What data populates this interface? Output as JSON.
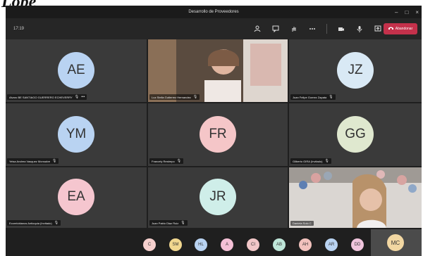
{
  "top_text": "Lope",
  "window": {
    "title": "Desarrollo de Proveedores",
    "minimize_glyph": "–",
    "maximize_glyph": "□",
    "close_glyph": "×"
  },
  "toolbar": {
    "timer": "17:19",
    "leave_label": "Abandonar",
    "icons": [
      "people-icon",
      "chat-icon",
      "raise-hand-icon",
      "more-options-icon",
      "camera-icon",
      "microphone-icon",
      "share-icon"
    ]
  },
  "tiles": [
    {
      "initials": "AE",
      "name": "Alvaro BE SANTIAGO GUERRERO ECHEVERRY",
      "color": "#b9d3f2"
    },
    {
      "initials": "",
      "name": "Luz Stella Gutierrez Hernandez",
      "color": "#c8a27c"
    },
    {
      "initials": "JZ",
      "name": "Juan Felipe Gomez Zapata",
      "color": "#d9e9f5"
    },
    {
      "initials": "YM",
      "name": "Yeisa Andrea Vasquez Monsalve",
      "color": "#b9d3f2"
    },
    {
      "initials": "FR",
      "name": "Francely Restrepo",
      "color": "#f5c6c8"
    },
    {
      "initials": "GG",
      "name": "Gilberto GIRA (Invitado)",
      "color": "#dfe8cf"
    },
    {
      "initials": "EA",
      "name": "Ecoreloblanos Antioquia (Invitado)",
      "color": "#f5c6cf"
    },
    {
      "initials": "JR",
      "name": "Juan Pablo Diaz Ruiz",
      "color": "#cfeee9"
    },
    {
      "initials": "",
      "name": "Daniela Solo C",
      "color": "#e7d6c7"
    }
  ],
  "bottom_avatars": [
    {
      "initials": "C",
      "color": "#f6d0ce"
    },
    {
      "initials": "SM",
      "color": "#f1d78f"
    },
    {
      "initials": "HL",
      "color": "#b9d3f2"
    },
    {
      "initials": "A",
      "color": "#f4c0d6"
    },
    {
      "initials": "CI",
      "color": "#f2c7c8"
    },
    {
      "initials": "AB",
      "color": "#bfe6d9"
    },
    {
      "initials": "AH",
      "color": "#f2c2bd"
    },
    {
      "initials": "AR",
      "color": "#b9d3f2"
    },
    {
      "initials": "DD",
      "color": "#f0c5dd"
    }
  ],
  "self_view": {
    "initials": "MC",
    "color": "#f2d7a2"
  }
}
